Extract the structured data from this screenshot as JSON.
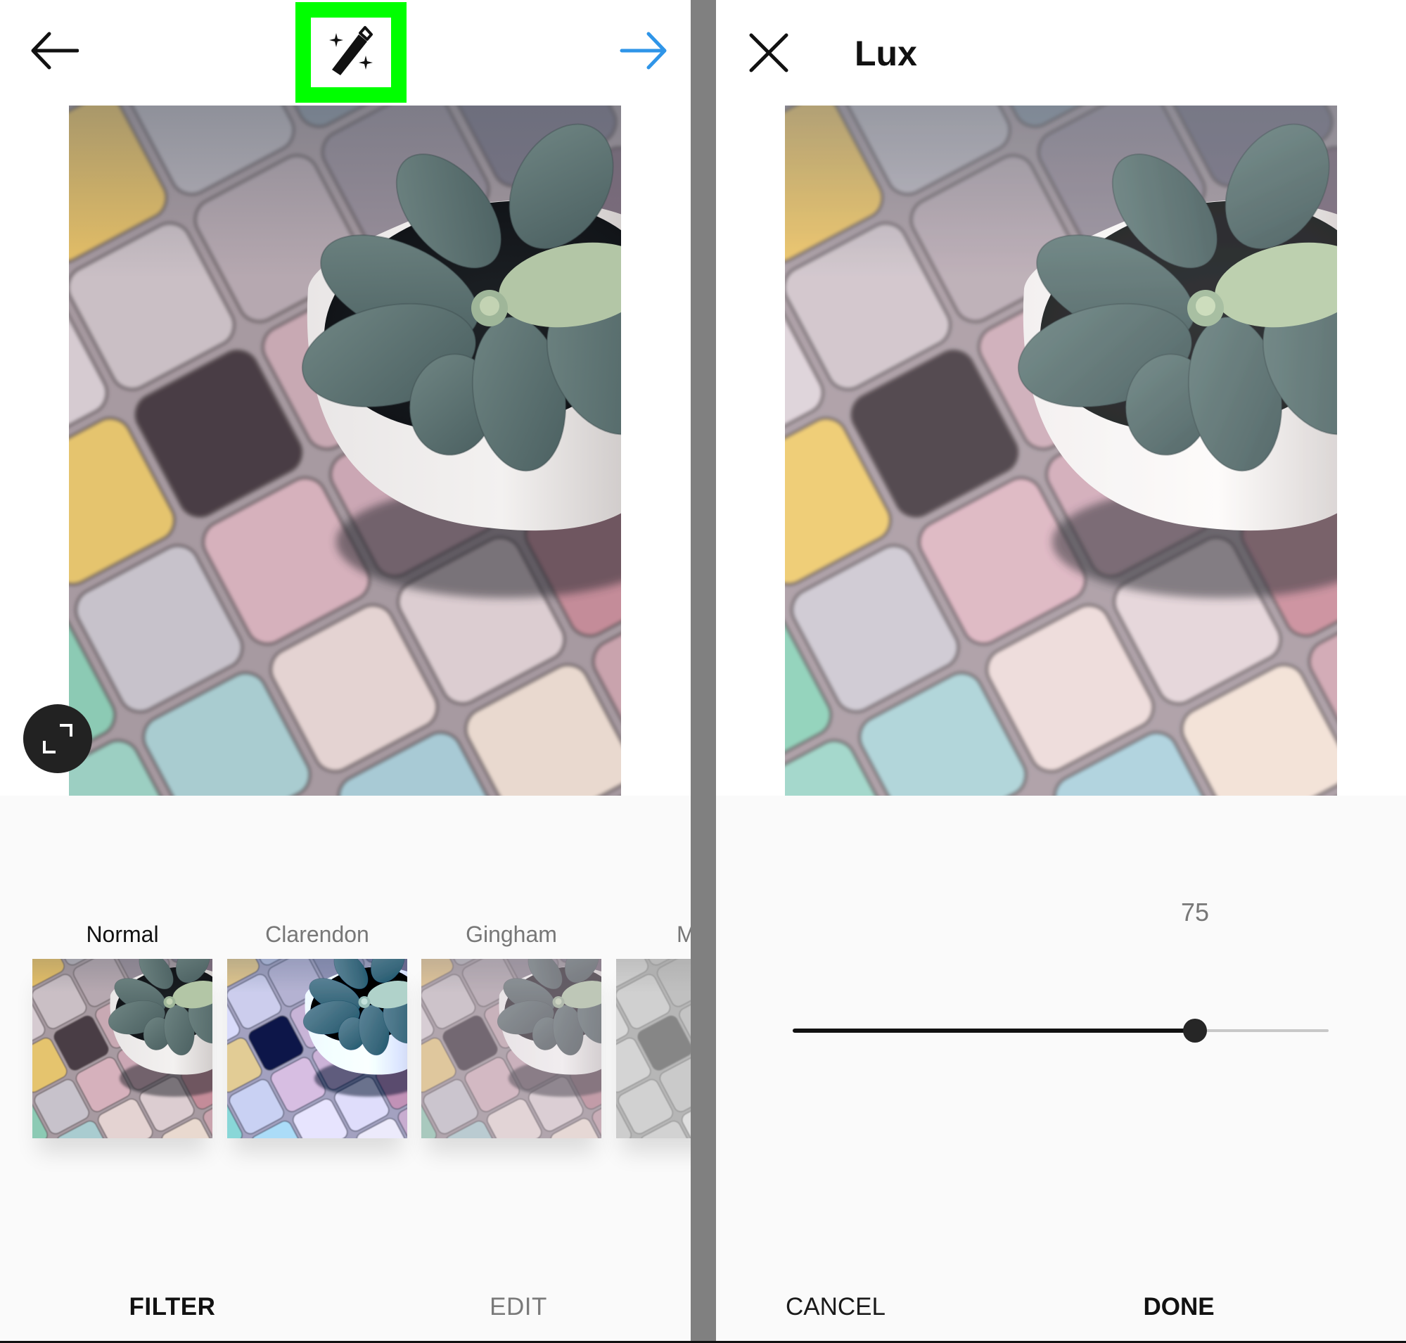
{
  "left_panel": {
    "header": {
      "back_icon": "arrow-left-icon",
      "tool_icon": "magic-wand-icon",
      "tool_highlight_color": "#00ff00",
      "next_icon": "arrow-right-icon",
      "next_color": "#2f95e8"
    },
    "photo": {
      "description": "Succulent in white pot on pastel tiles",
      "filter": "Normal"
    },
    "expand_icon": "expand-icon",
    "filters": [
      {
        "label": "Normal",
        "selected": true,
        "style": "normal"
      },
      {
        "label": "Clarendon",
        "selected": false,
        "style": "clarendon"
      },
      {
        "label": "Gingham",
        "selected": false,
        "style": "gingham"
      },
      {
        "label": "M",
        "selected": false,
        "style": "mono",
        "truncated": true
      }
    ],
    "tabs": [
      {
        "label": "FILTER",
        "active": true
      },
      {
        "label": "EDIT",
        "active": false
      }
    ]
  },
  "right_panel": {
    "header": {
      "close_icon": "close-icon",
      "title": "Lux"
    },
    "photo": {
      "description": "Succulent in white pot on pastel tiles",
      "filter": "Lux"
    },
    "slider": {
      "value": "75",
      "min": 0,
      "max": 100,
      "fraction": 0.75
    },
    "buttons": {
      "cancel": "CANCEL",
      "done": "DONE"
    }
  }
}
